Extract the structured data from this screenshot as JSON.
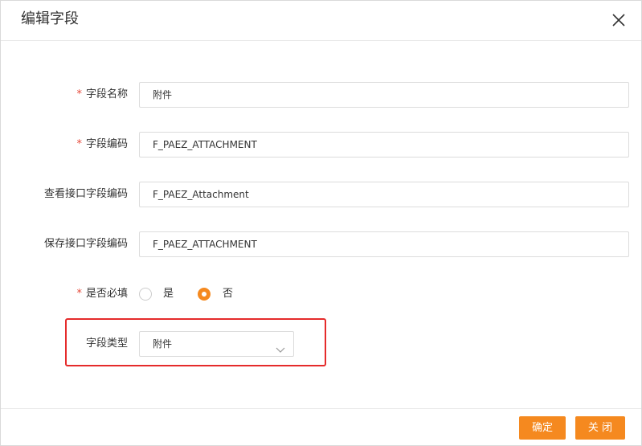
{
  "dialog": {
    "title": "编辑字段"
  },
  "form": {
    "field_name": {
      "label": "字段名称",
      "required_mark": "*",
      "value": "附件"
    },
    "field_code": {
      "label": "字段编码",
      "required_mark": "*",
      "value": "F_PAEZ_ATTACHMENT"
    },
    "query_api_code": {
      "label": "查看接口字段编码",
      "value": "F_PAEZ_Attachment"
    },
    "save_api_code": {
      "label": "保存接口字段编码",
      "value": "F_PAEZ_ATTACHMENT"
    },
    "required": {
      "label": "是否必填",
      "required_mark": "*",
      "options": [
        "是",
        "否"
      ],
      "selected": "否"
    },
    "field_type": {
      "label": "字段类型",
      "selected": "附件"
    }
  },
  "footer": {
    "confirm_label": "确定",
    "close_label": "关 闭"
  },
  "colors": {
    "accent": "#f5891f",
    "required_mark": "#e64a3b",
    "highlight_box": "#e52b2b"
  }
}
